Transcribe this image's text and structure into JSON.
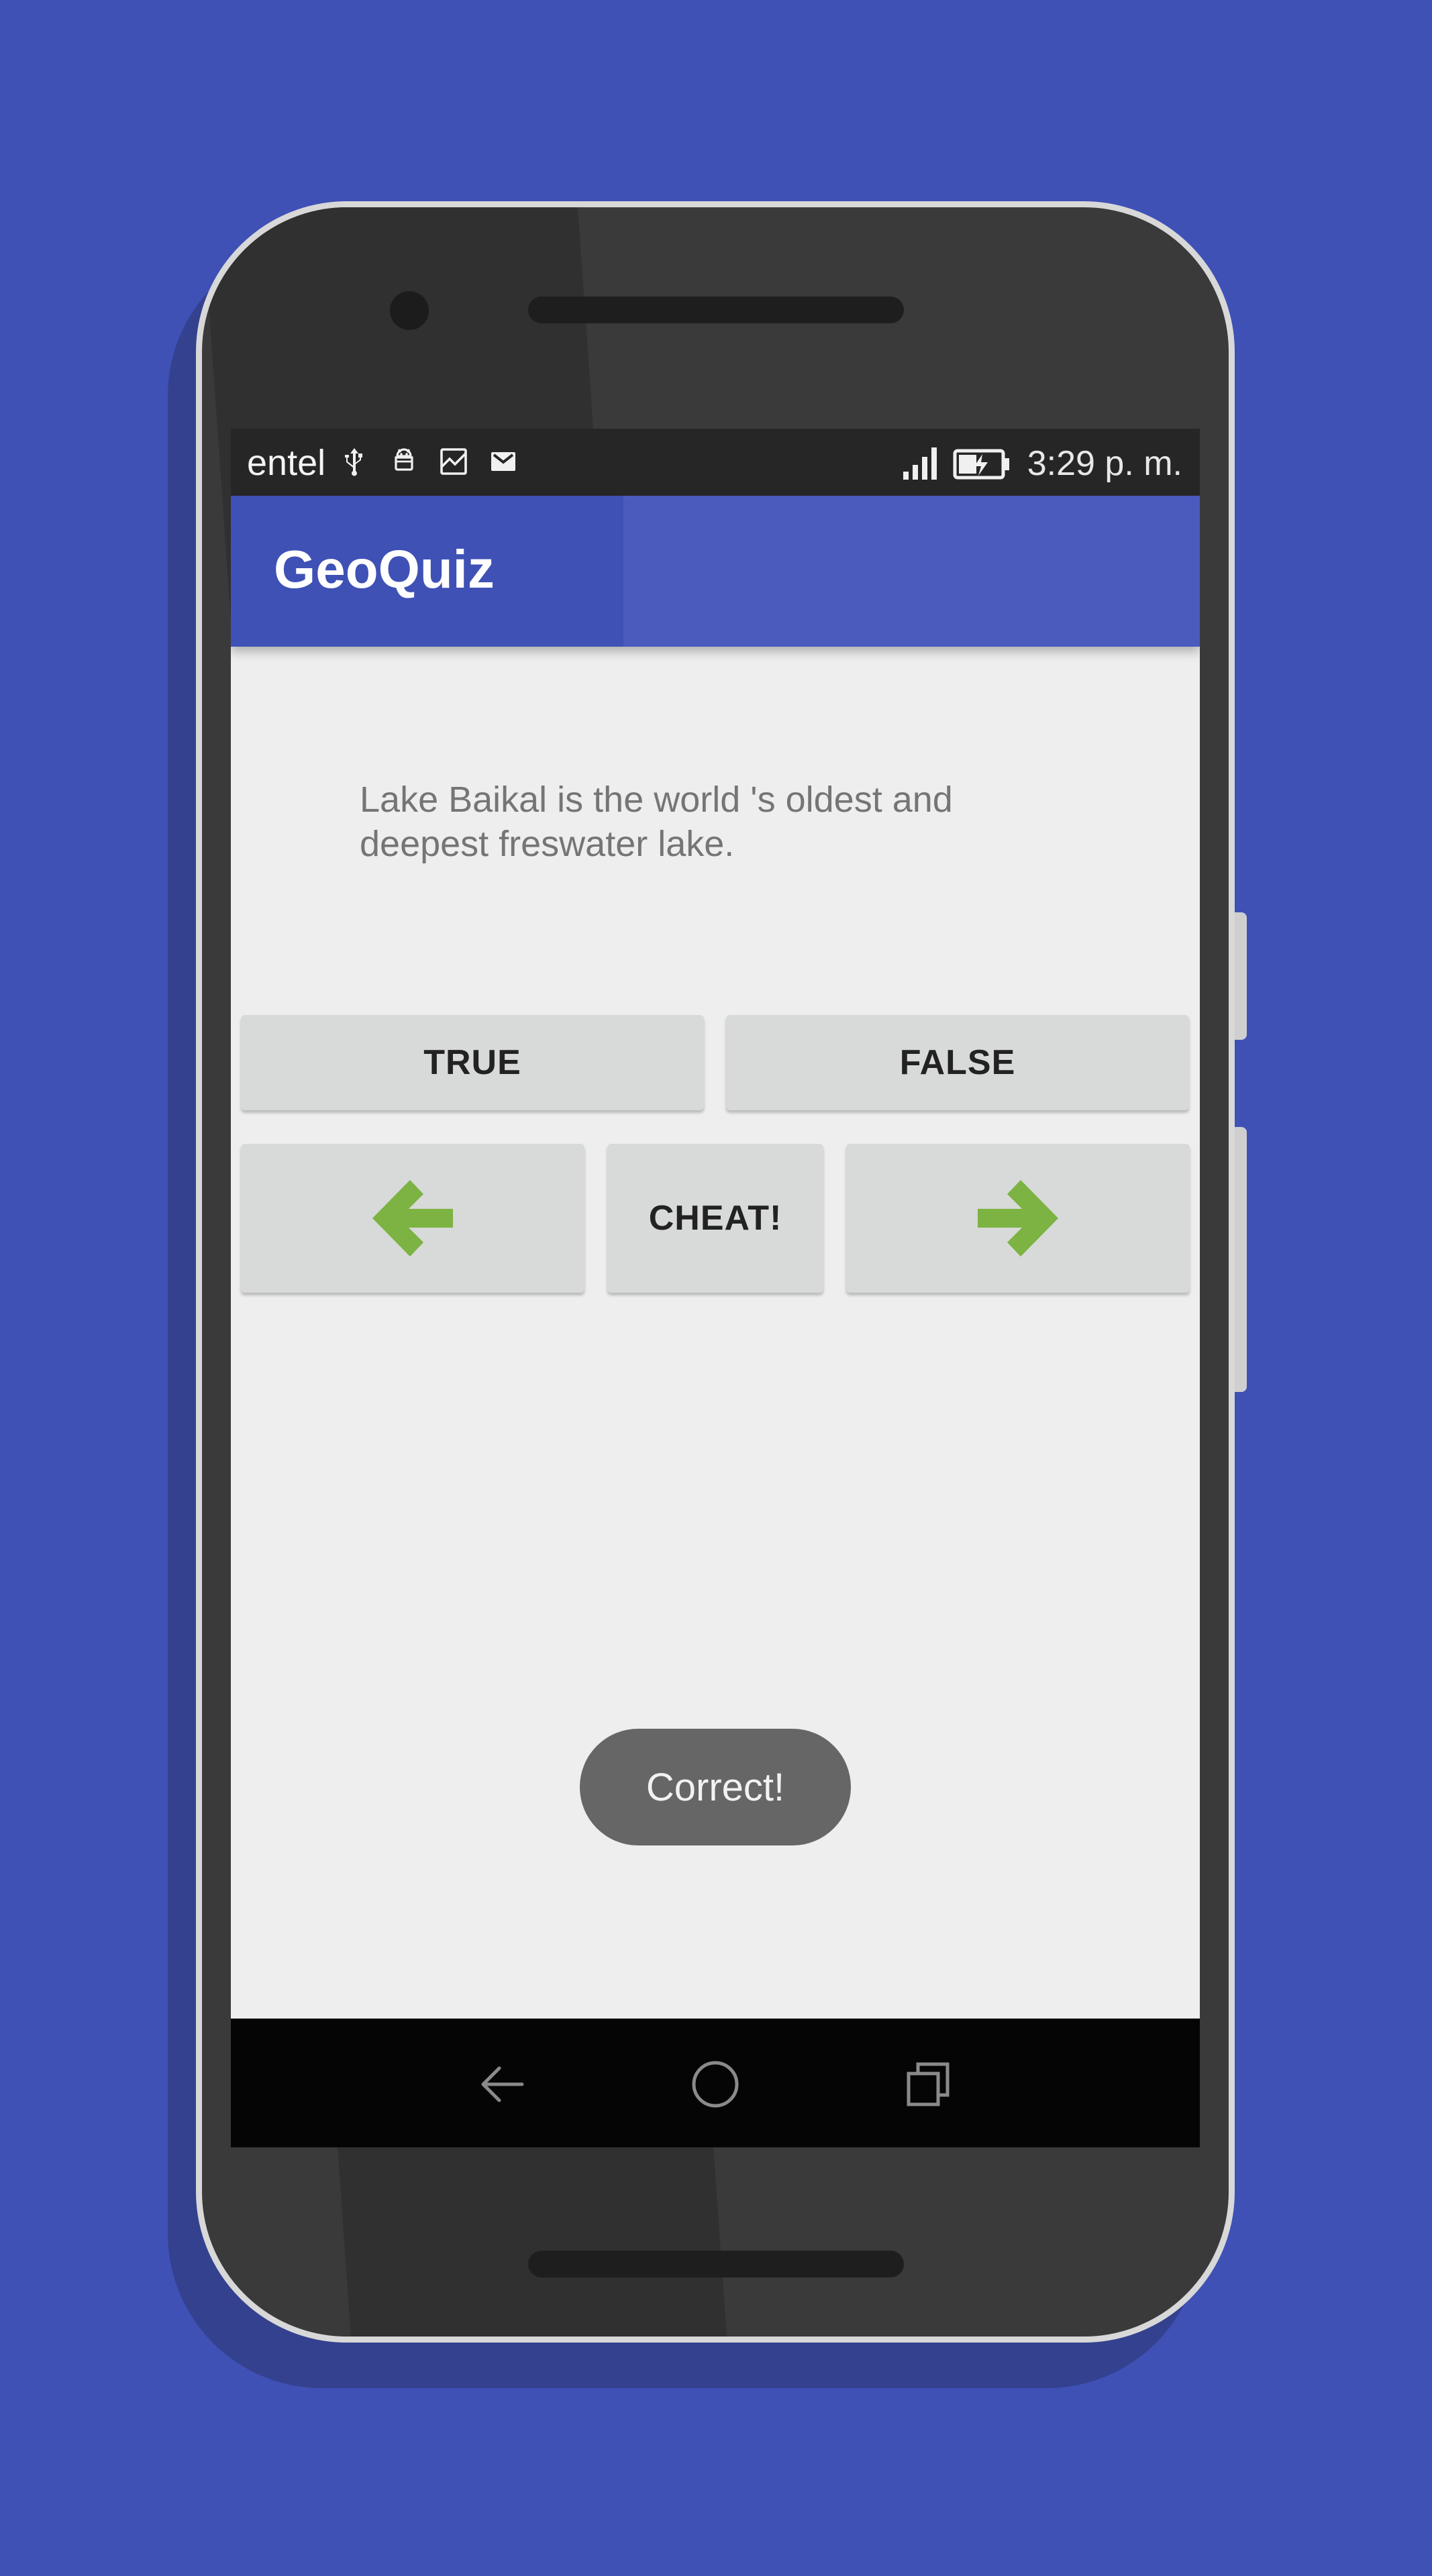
{
  "status_bar": {
    "carrier": "entel",
    "time": "3:29 p. m.",
    "icons": [
      "usb-icon",
      "android-debug-icon",
      "image-icon",
      "gmail-icon",
      "signal-icon",
      "battery-charging-icon"
    ]
  },
  "app_bar": {
    "title": "GeoQuiz"
  },
  "question": {
    "text": "Lake Baikal is the world 's oldest and deepest freswater lake."
  },
  "buttons": {
    "true_label": "TRUE",
    "false_label": "FALSE",
    "cheat_label": "CHEAT!",
    "prev_icon": "arrow-left-icon",
    "next_icon": "arrow-right-icon"
  },
  "toast": {
    "text": "Correct!"
  },
  "nav_bar": {
    "icons": [
      "back-icon",
      "home-icon",
      "recents-icon"
    ]
  },
  "colors": {
    "background": "#3f51b5",
    "app_bar": "#3f51b5",
    "arrow": "#7cb342",
    "toast": "#666666"
  }
}
